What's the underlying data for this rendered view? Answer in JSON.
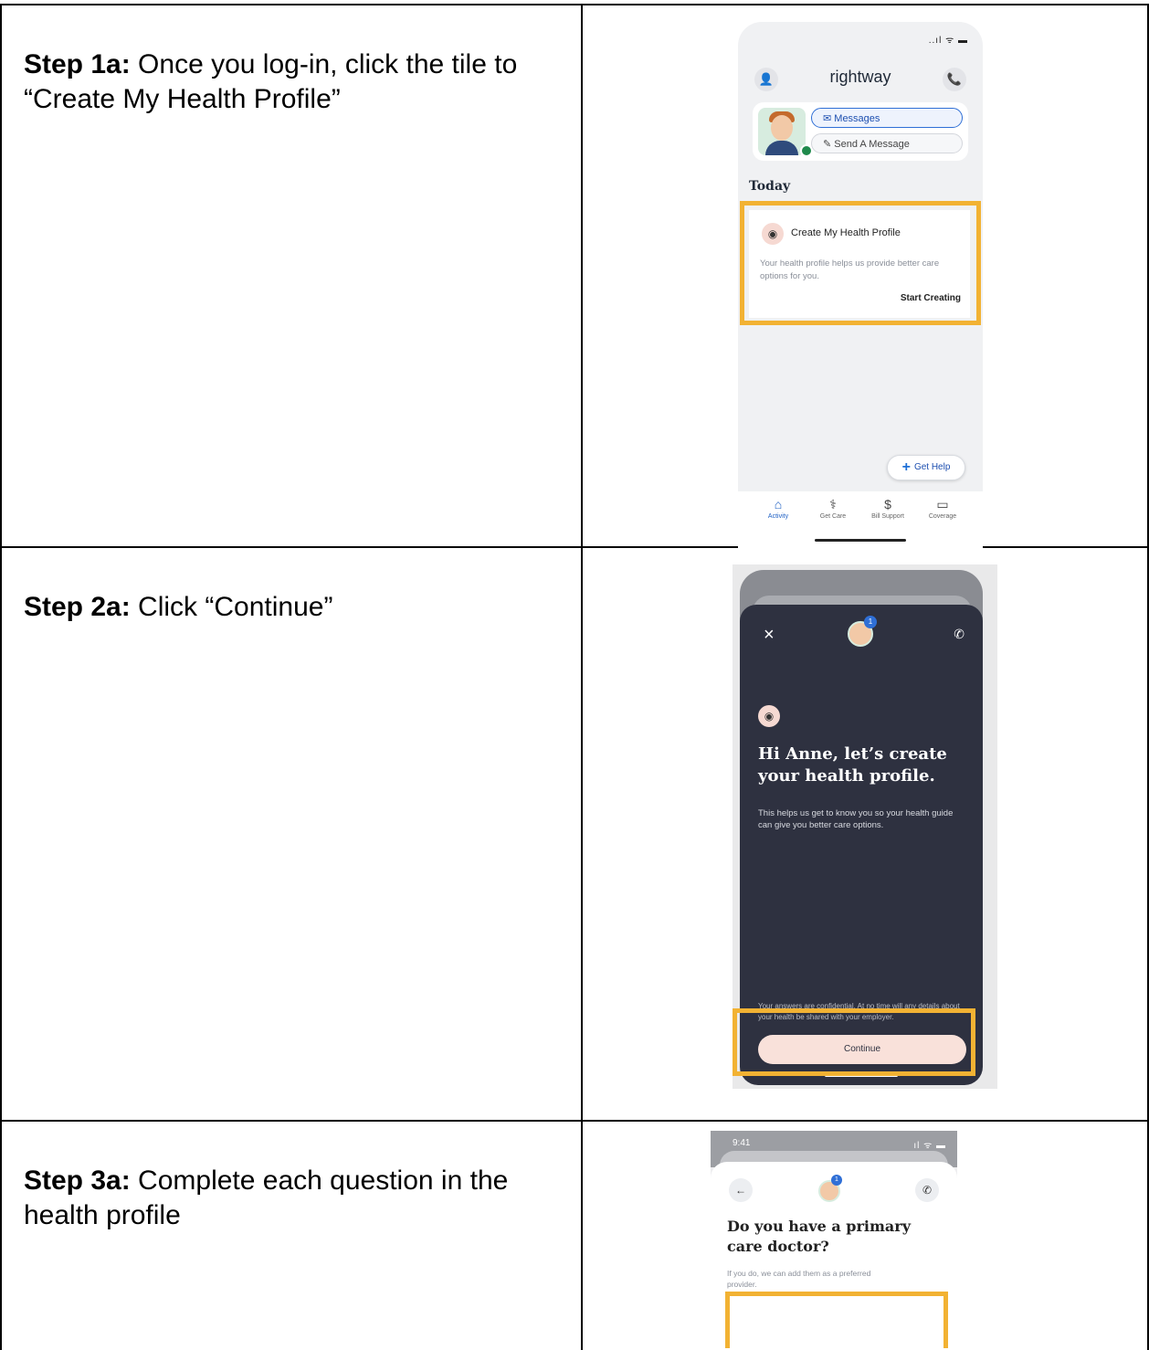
{
  "steps": [
    {
      "label": "Step 1a:",
      "text": " Once you log-in, click the tile to “Create My Health Profile”",
      "screen": {
        "status_icons": "..ıl ᯤ ▬",
        "brand": "rightway",
        "messages_label": "Messages",
        "send_message_label": "Send A Message",
        "section_title": "Today",
        "tile_title": "Create My Health Profile",
        "tile_description": "Your health profile helps us provide better care options for you.",
        "tile_cta": "Start Creating",
        "get_help_label": "Get Help",
        "tabs": [
          "Activity",
          "Get Care",
          "Bill Support",
          "Coverage"
        ]
      }
    },
    {
      "label": "Step 2a:",
      "text": " Click “Continue”",
      "screen": {
        "badge": "1",
        "headline": "Hi Anne, let’s create your health profile.",
        "body": "This helps us get to know you so your health guide can give you better care options.",
        "confidential": "Your answers are confidential. At no time will any details about your health be shared with your employer.",
        "continue_label": "Continue"
      }
    },
    {
      "label": "Step 3a:",
      "text": " Complete each question in the health profile",
      "screen": {
        "time": "9:41",
        "badge": "1",
        "question": "Do you have a primary care doctor?",
        "subtext": "If you do, we can add them as a preferred provider."
      }
    }
  ],
  "highlight_color": "#f2b233"
}
